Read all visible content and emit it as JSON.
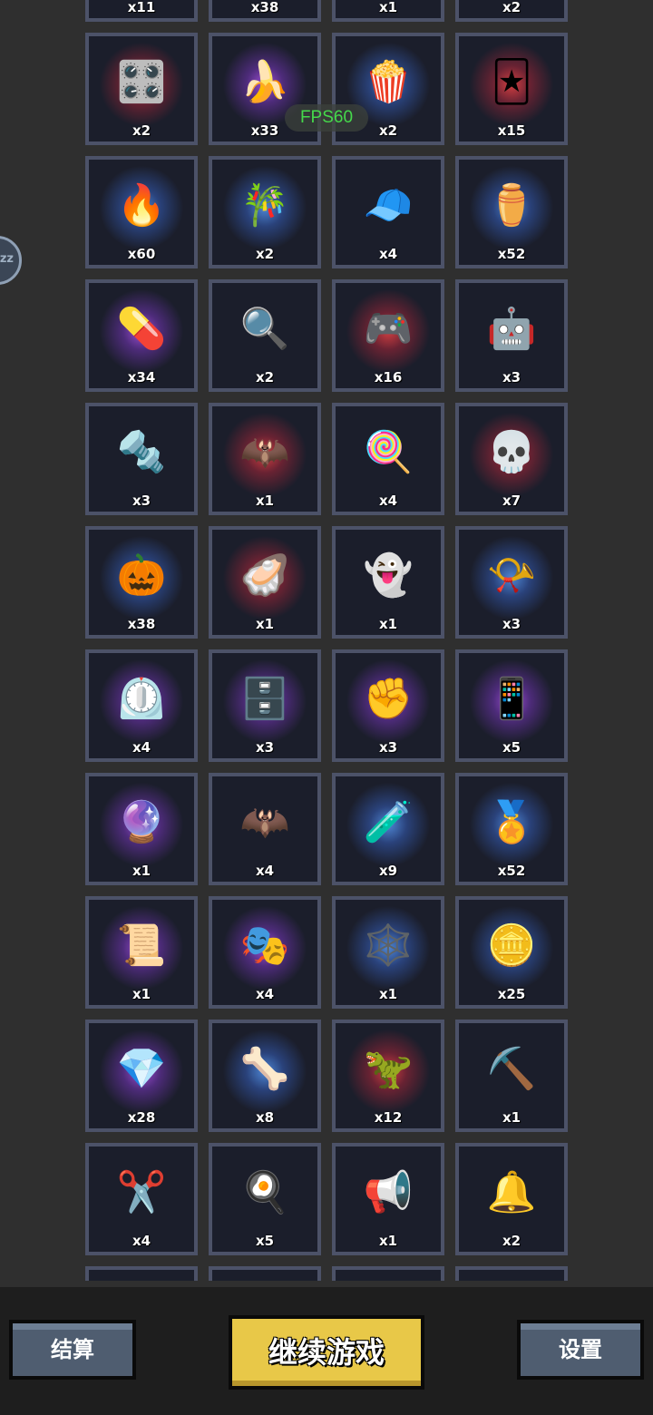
{
  "overlay": {
    "fps": "FPS60",
    "side_handle": "zz"
  },
  "inventory": {
    "items": [
      {
        "icon": "unknown-item-icon",
        "emoji": "",
        "glow": "none",
        "count": "x11"
      },
      {
        "icon": "unknown-item-icon",
        "emoji": "",
        "glow": "none",
        "count": "x38"
      },
      {
        "icon": "unknown-item-icon",
        "emoji": "",
        "glow": "none",
        "count": "x1"
      },
      {
        "icon": "unknown-item-icon",
        "emoji": "",
        "glow": "none",
        "count": "x2"
      },
      {
        "icon": "graphics-card-icon",
        "emoji": "🎛️",
        "glow": "red",
        "count": "x2"
      },
      {
        "icon": "banana-icon",
        "emoji": "🍌",
        "glow": "purple",
        "count": "x33"
      },
      {
        "icon": "popcorn-icon",
        "emoji": "🍿",
        "glow": "blue",
        "count": "x2"
      },
      {
        "icon": "mystery-card-icon",
        "emoji": "🃏",
        "glow": "red",
        "count": "x15"
      },
      {
        "icon": "fire-icon",
        "emoji": "🔥",
        "glow": "blue",
        "count": "x60"
      },
      {
        "icon": "bamboo-icon",
        "emoji": "🎋",
        "glow": "blue",
        "count": "x2"
      },
      {
        "icon": "cap-icon",
        "emoji": "🧢",
        "glow": "none",
        "count": "x4"
      },
      {
        "icon": "urn-icon",
        "emoji": "⚱️",
        "glow": "blue",
        "count": "x52"
      },
      {
        "icon": "pill-icon",
        "emoji": "💊",
        "glow": "purple",
        "count": "x34"
      },
      {
        "icon": "magnifier-icon",
        "emoji": "🔍",
        "glow": "none",
        "count": "x2"
      },
      {
        "icon": "gamepad-icon",
        "emoji": "🎮",
        "glow": "red",
        "count": "x16"
      },
      {
        "icon": "robot-claw-icon",
        "emoji": "🤖",
        "glow": "none",
        "count": "x3"
      },
      {
        "icon": "screw-icon",
        "emoji": "🔩",
        "glow": "none",
        "count": "x3"
      },
      {
        "icon": "demon-wing-icon",
        "emoji": "🦇",
        "glow": "red",
        "count": "x1"
      },
      {
        "icon": "lollipop-icon",
        "emoji": "🍭",
        "glow": "none",
        "count": "x4"
      },
      {
        "icon": "skull-icon",
        "emoji": "💀",
        "glow": "red",
        "count": "x7"
      },
      {
        "icon": "pumpkin-icon",
        "emoji": "🎃",
        "glow": "blue",
        "count": "x38"
      },
      {
        "icon": "pearl-shell-icon",
        "emoji": "🦪",
        "glow": "red",
        "count": "x1"
      },
      {
        "icon": "ghost-creature-icon",
        "emoji": "👻",
        "glow": "none",
        "count": "x1"
      },
      {
        "icon": "horn-icon",
        "emoji": "📯",
        "glow": "blue",
        "count": "x3"
      },
      {
        "icon": "timer-icon",
        "emoji": "⏲️",
        "glow": "purple",
        "count": "x4"
      },
      {
        "icon": "cage-icon",
        "emoji": "🗄️",
        "glow": "purple",
        "count": "x3"
      },
      {
        "icon": "fist-icon",
        "emoji": "✊",
        "glow": "purple",
        "count": "x3"
      },
      {
        "icon": "tablet-icon",
        "emoji": "📱",
        "glow": "purple",
        "count": "x5"
      },
      {
        "icon": "crystal-icon",
        "emoji": "🔮",
        "glow": "purple",
        "count": "x1"
      },
      {
        "icon": "bat-wing-icon",
        "emoji": "🦇",
        "glow": "none",
        "count": "x4"
      },
      {
        "icon": "potion-icon",
        "emoji": "🧪",
        "glow": "blue",
        "count": "x9"
      },
      {
        "icon": "medal-icon",
        "emoji": "🏅",
        "glow": "blue",
        "count": "x52"
      },
      {
        "icon": "scroll-roll-icon",
        "emoji": "📜",
        "glow": "purple",
        "count": "x1"
      },
      {
        "icon": "mask-icon",
        "emoji": "🎭",
        "glow": "purple",
        "count": "x4"
      },
      {
        "icon": "spider-web-icon",
        "emoji": "🕸️",
        "glow": "blue",
        "count": "x1"
      },
      {
        "icon": "gold-coin-alert-icon",
        "emoji": "🪙",
        "glow": "blue",
        "count": "x25"
      },
      {
        "icon": "diamond-icon",
        "emoji": "💎",
        "glow": "purple",
        "count": "x28"
      },
      {
        "icon": "bone-icon",
        "emoji": "🦴",
        "glow": "blue",
        "count": "x8"
      },
      {
        "icon": "monster-jaw-icon",
        "emoji": "🦖",
        "glow": "red",
        "count": "x12"
      },
      {
        "icon": "pickaxe-icon",
        "emoji": "⛏️",
        "glow": "none",
        "count": "x1"
      },
      {
        "icon": "scissors-icon",
        "emoji": "✂️",
        "glow": "none",
        "count": "x4"
      },
      {
        "icon": "frying-pan-icon",
        "emoji": "🍳",
        "glow": "none",
        "count": "x5"
      },
      {
        "icon": "whistle-icon",
        "emoji": "📢",
        "glow": "none",
        "count": "x1"
      },
      {
        "icon": "bell-icon",
        "emoji": "🔔",
        "glow": "none",
        "count": "x2"
      },
      {
        "icon": "unknown-item-icon",
        "emoji": "",
        "glow": "none",
        "count": ""
      },
      {
        "icon": "unknown-item-icon",
        "emoji": "",
        "glow": "none",
        "count": ""
      },
      {
        "icon": "unknown-item-icon",
        "emoji": "",
        "glow": "none",
        "count": ""
      },
      {
        "icon": "unknown-item-icon",
        "emoji": "",
        "glow": "none",
        "count": ""
      }
    ]
  },
  "bottom_bar": {
    "settle_label": "结算",
    "continue_label": "继续游戏",
    "settings_label": "设置",
    "colors": {
      "primary_button": "#e8c848",
      "secondary_button": "#4f5d70",
      "fps_text": "#45d94b"
    }
  }
}
